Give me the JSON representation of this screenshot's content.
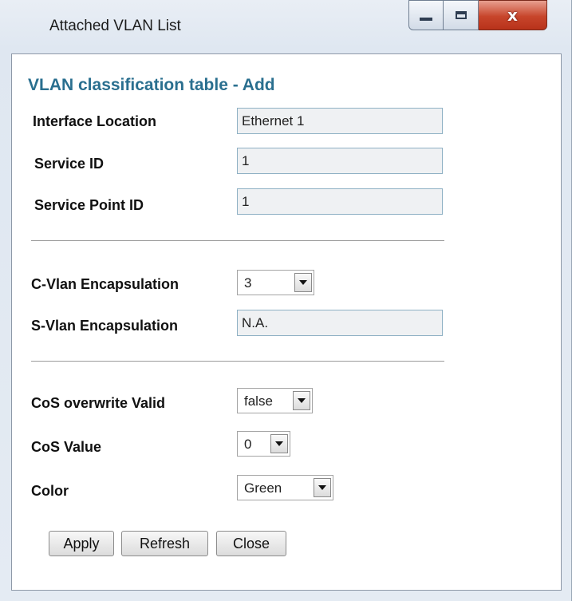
{
  "window": {
    "title": "Attached VLAN List",
    "controls": {
      "minimize": "minimize-icon",
      "maximize": "maximize-icon",
      "close": "x"
    }
  },
  "form": {
    "heading": "VLAN classification table - Add",
    "interface_location": {
      "label": "Interface Location",
      "value": "Ethernet 1"
    },
    "service_id": {
      "label": "Service ID",
      "value": "1"
    },
    "service_point_id": {
      "label": "Service Point ID",
      "value": "1"
    },
    "c_vlan": {
      "label": "C-Vlan Encapsulation",
      "value": "3"
    },
    "s_vlan": {
      "label": "S-Vlan Encapsulation",
      "value": "N.A."
    },
    "cos_overwrite": {
      "label": "CoS overwrite Valid",
      "value": "false"
    },
    "cos_value": {
      "label": "CoS Value",
      "value": "0"
    },
    "color": {
      "label": "Color",
      "value": "Green"
    }
  },
  "buttons": {
    "apply": "Apply",
    "refresh": "Refresh",
    "close": "Close"
  },
  "colors": {
    "heading": "#2a6f8f",
    "close_button": "#c7452b",
    "field_bg": "#eff1f3"
  }
}
